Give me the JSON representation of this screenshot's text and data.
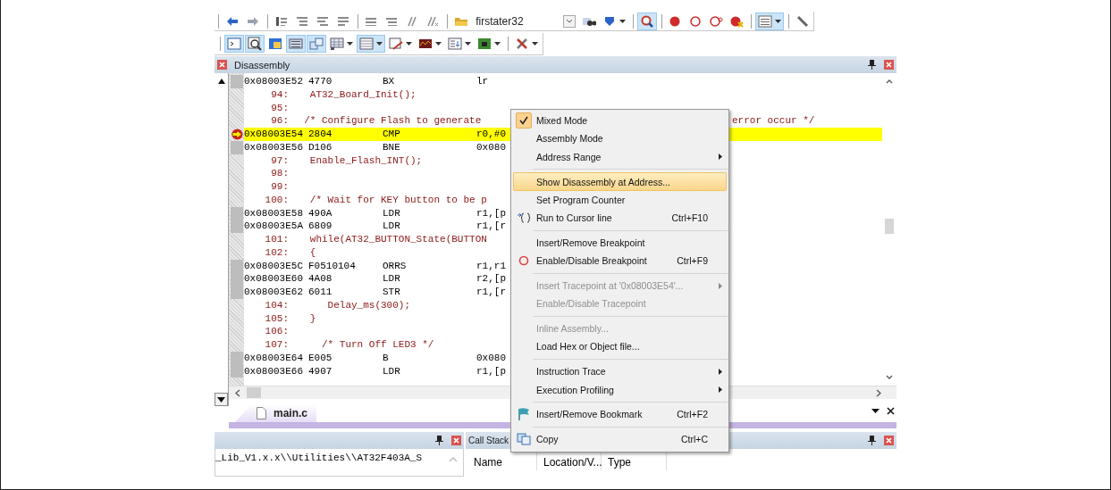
{
  "toolbars": [
    {
      "items": [
        {
          "kind": "separator"
        },
        {
          "kind": "button",
          "on": false,
          "dropdown": false
        },
        {
          "kind": "button",
          "on": false,
          "dropdown": false
        },
        {
          "kind": "separator"
        },
        {
          "kind": "button",
          "on": false,
          "dropdown": false
        },
        {
          "kind": "button",
          "on": false,
          "dropdown": false
        },
        {
          "kind": "button",
          "on": false,
          "dropdown": false
        },
        {
          "kind": "button",
          "on": false,
          "dropdown": false
        },
        {
          "kind": "separator"
        },
        {
          "kind": "button",
          "on": false,
          "dropdown": false
        },
        {
          "kind": "button",
          "on": false,
          "dropdown": false
        },
        {
          "kind": "button",
          "on": false,
          "dropdown": false
        },
        {
          "kind": "button",
          "on": false,
          "dropdown": false
        },
        {
          "kind": "separator"
        },
        {
          "kind": "button",
          "on": false,
          "dropdown": false
        },
        {
          "kind": "combo",
          "value": "firstater32"
        },
        {
          "kind": "button",
          "on": false,
          "dropdown": false
        },
        {
          "kind": "button",
          "on": false,
          "dropdown": true
        },
        {
          "kind": "separator"
        },
        {
          "kind": "button",
          "on": true,
          "dropdown": false
        },
        {
          "kind": "separator"
        },
        {
          "kind": "button",
          "on": false,
          "dropdown": false
        },
        {
          "kind": "button",
          "on": false,
          "dropdown": false
        },
        {
          "kind": "button",
          "on": false,
          "dropdown": false
        },
        {
          "kind": "button",
          "on": false,
          "dropdown": false
        },
        {
          "kind": "separator"
        },
        {
          "kind": "button",
          "on": true,
          "dropdown": true
        },
        {
          "kind": "separator"
        },
        {
          "kind": "button",
          "on": false,
          "dropdown": false
        }
      ]
    },
    {
      "items": [
        {
          "kind": "separator"
        },
        {
          "kind": "button",
          "on": true,
          "dropdown": false
        },
        {
          "kind": "button",
          "on": true,
          "dropdown": false
        },
        {
          "kind": "button",
          "on": false,
          "dropdown": false
        },
        {
          "kind": "button",
          "on": true,
          "dropdown": false
        },
        {
          "kind": "button",
          "on": true,
          "dropdown": false
        },
        {
          "kind": "button",
          "on": false,
          "dropdown": true
        },
        {
          "kind": "button",
          "on": true,
          "dropdown": true
        },
        {
          "kind": "button",
          "on": false,
          "dropdown": true
        },
        {
          "kind": "button",
          "on": false,
          "dropdown": true
        },
        {
          "kind": "button",
          "on": false,
          "dropdown": true
        },
        {
          "kind": "button",
          "on": false,
          "dropdown": true
        },
        {
          "kind": "separator"
        },
        {
          "kind": "button",
          "on": false,
          "dropdown": true
        }
      ]
    }
  ],
  "disassembly": {
    "title": "Disassembly",
    "lines": [
      {
        "kind": "asm",
        "current": false,
        "address": "0x08003E52",
        "opcode": "4770",
        "mnemonic": "BX",
        "operands": "lr"
      },
      {
        "kind": "src",
        "number": "94:",
        "text": "   AT32_Board_Init();"
      },
      {
        "kind": "src",
        "number": "95:"
      },
      {
        "kind": "src",
        "number": "96:",
        "text": "  /* Configure Flash to generate",
        "tail": "error occur */"
      },
      {
        "kind": "asm",
        "current": true,
        "address": "0x08003E54",
        "opcode": "2804",
        "mnemonic": "CMP",
        "operands": "r0,#0"
      },
      {
        "kind": "asm",
        "current": false,
        "address": "0x08003E56",
        "opcode": "D106",
        "mnemonic": "BNE",
        "operands": "0x080"
      },
      {
        "kind": "src",
        "number": "97:",
        "text": "   Enable_Flash_INT();"
      },
      {
        "kind": "src",
        "number": "98:"
      },
      {
        "kind": "src",
        "number": "99:"
      },
      {
        "kind": "src",
        "number": "100:",
        "text": "   /* Wait for KEY button to be p"
      },
      {
        "kind": "asm",
        "current": false,
        "address": "0x08003E58",
        "opcode": "490A",
        "mnemonic": "LDR",
        "operands": "r1,[p"
      },
      {
        "kind": "asm",
        "current": false,
        "address": "0x08003E5A",
        "opcode": "6809",
        "mnemonic": "LDR",
        "operands": "r1,[r"
      },
      {
        "kind": "src",
        "number": "101:",
        "text": "   while(AT32_BUTTON_State(BUTTON"
      },
      {
        "kind": "src",
        "number": "102:",
        "text": "   {"
      },
      {
        "kind": "asm",
        "current": false,
        "address": "0x08003E5C",
        "opcode": "F0510104",
        "mnemonic": "ORRS",
        "operands": "r1,r1"
      },
      {
        "kind": "asm",
        "current": false,
        "address": "0x08003E60",
        "opcode": "4A08",
        "mnemonic": "LDR",
        "operands": "r2,[p"
      },
      {
        "kind": "asm",
        "current": false,
        "address": "0x08003E62",
        "opcode": "6011",
        "mnemonic": "STR",
        "operands": "r1,[r"
      },
      {
        "kind": "src",
        "number": "104:",
        "text": "      Delay_ms(300);"
      },
      {
        "kind": "src",
        "number": "105:",
        "text": "   }"
      },
      {
        "kind": "src",
        "number": "106:"
      },
      {
        "kind": "src",
        "number": "107:",
        "text": "     /* Turn Off LED3 */"
      },
      {
        "kind": "asm",
        "current": false,
        "address": "0x08003E64",
        "opcode": "E005",
        "mnemonic": "B",
        "operands": "0x080"
      },
      {
        "kind": "asm",
        "current": false,
        "address": "0x08003E66",
        "opcode": "4907",
        "mnemonic": "LDR",
        "operands": "r1,[p"
      }
    ]
  },
  "editor_tabs": [
    {
      "label": "main.c",
      "selected": true
    }
  ],
  "output_panel": {
    "text": "_Lib_V1.x.x\\\\Utilities\\\\AT32F403A_S"
  },
  "call_stack": {
    "title": "Call Stack",
    "columns": [
      "Name",
      "Location/V...",
      "Type"
    ]
  },
  "context_menu": {
    "items": [
      {
        "kind": "item",
        "label": "Mixed Mode",
        "checked": true,
        "selected": false,
        "disabled": false,
        "submenu": false
      },
      {
        "kind": "item",
        "label": "Assembly Mode",
        "checked": false,
        "selected": false,
        "disabled": false,
        "submenu": false
      },
      {
        "kind": "item",
        "label": "Address Range",
        "checked": false,
        "selected": false,
        "disabled": false,
        "submenu": true
      },
      {
        "kind": "separator"
      },
      {
        "kind": "item",
        "label": "Show Disassembly at Address...",
        "checked": false,
        "selected": true,
        "disabled": false,
        "submenu": false
      },
      {
        "kind": "item",
        "label": "Set Program Counter",
        "checked": false,
        "selected": false,
        "disabled": false,
        "submenu": false
      },
      {
        "kind": "item",
        "label": "Run to Cursor line",
        "shortcut": "Ctrl+F10",
        "checked": false,
        "selected": false,
        "disabled": false,
        "submenu": false
      },
      {
        "kind": "separator"
      },
      {
        "kind": "item",
        "label": "Insert/Remove Breakpoint",
        "checked": false,
        "selected": false,
        "disabled": false,
        "submenu": false
      },
      {
        "kind": "item",
        "label": "Enable/Disable Breakpoint",
        "shortcut": "Ctrl+F9",
        "checked": false,
        "selected": false,
        "disabled": false,
        "submenu": false
      },
      {
        "kind": "separator"
      },
      {
        "kind": "item",
        "label": "Insert Tracepoint at '0x08003E54'...",
        "checked": false,
        "selected": false,
        "disabled": true,
        "submenu": true
      },
      {
        "kind": "item",
        "label": "Enable/Disable Tracepoint",
        "checked": false,
        "selected": false,
        "disabled": true,
        "submenu": false
      },
      {
        "kind": "separator"
      },
      {
        "kind": "item",
        "label": "Inline Assembly...",
        "checked": false,
        "selected": false,
        "disabled": true,
        "submenu": false
      },
      {
        "kind": "item",
        "label": "Load Hex or Object file...",
        "checked": false,
        "selected": false,
        "disabled": false,
        "submenu": false
      },
      {
        "kind": "separator"
      },
      {
        "kind": "item",
        "label": "Instruction Trace",
        "checked": false,
        "selected": false,
        "disabled": false,
        "submenu": true
      },
      {
        "kind": "item",
        "label": "Execution Profiling",
        "checked": false,
        "selected": false,
        "disabled": false,
        "submenu": true
      },
      {
        "kind": "separator"
      },
      {
        "kind": "item",
        "label": "Insert/Remove Bookmark",
        "shortcut": "Ctrl+F2",
        "checked": false,
        "selected": false,
        "disabled": false,
        "submenu": false
      },
      {
        "kind": "separator"
      },
      {
        "kind": "item",
        "label": "Copy",
        "shortcut": "Ctrl+C",
        "checked": false,
        "selected": false,
        "disabled": false,
        "submenu": false
      }
    ]
  }
}
